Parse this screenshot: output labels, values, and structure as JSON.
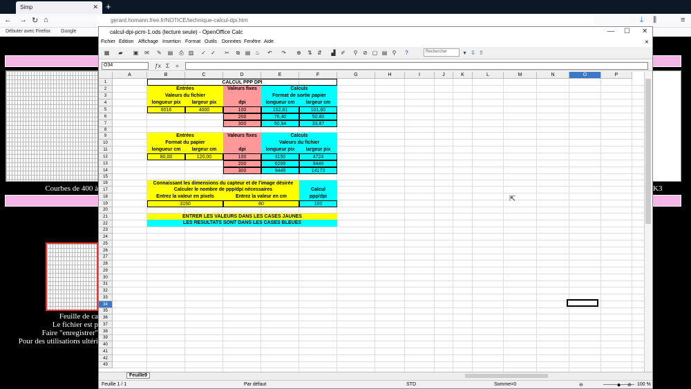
{
  "browser": {
    "tab_title": "Simp",
    "url": "gerard.homann.free.fr/NOTICE/technique-calcul-dpi.htm",
    "bookmarks": [
      "Débuter avec Firefox",
      "Google"
    ]
  },
  "page": {
    "caption1": "Courbes de 400 à",
    "caption_right": "K3",
    "lines": [
      "Feuille de ca",
      "Le fichier est p",
      "Faire \"enregistrer\"",
      "Pour des utilisations ultéri"
    ]
  },
  "calc": {
    "title": "calcul-dpi-pcm-1.ods (lecture seule) - OpenOffice Calc",
    "menu": [
      "Fichier",
      "Edition",
      "Affichage",
      "Insertion",
      "Format",
      "Outils",
      "Données",
      "Fenêtre",
      "Aide"
    ],
    "search_placeholder": "Rechercher",
    "namebox": "O34",
    "columns": [
      "A",
      "B",
      "C",
      "D",
      "E",
      "F",
      "G",
      "H",
      "I",
      "J",
      "K",
      "L",
      "M",
      "N",
      "O",
      "P"
    ],
    "rows": [
      "1",
      "2",
      "3",
      "4",
      "5",
      "6",
      "7",
      "8",
      "9",
      "10",
      "11",
      "12",
      "13",
      "14",
      "15",
      "16",
      "17",
      "18",
      "19",
      "20",
      "21",
      "22",
      "23",
      "24",
      "25",
      "26",
      "27",
      "28",
      "29",
      "30",
      "31",
      "32",
      "33",
      "34",
      "35",
      "36",
      "37",
      "38",
      "39",
      "40",
      "41",
      "42",
      "43"
    ],
    "sheet_tab": "Feuille9",
    "status": {
      "sheet": "Feuille 1 / 1",
      "style": "Par défaut",
      "mode": "STD",
      "sum": "Somme=0",
      "zoom": "100 %"
    },
    "cells": {
      "r1": "CALCUL PPP DPI",
      "r2b": "Entrées",
      "r2d": "Valeurs fixes",
      "r2e": "Calculs",
      "r3b": "Valeurs du fichier",
      "r3e": "Format de sortie papier",
      "r4b": "longueur pix",
      "r4c": "largeur pix",
      "r4d": "dpi",
      "r4e": "longueur cm",
      "r4f": "largeur cm",
      "r5b": "6016",
      "r5c": "4000",
      "r5d": "100",
      "r5e": "152,81",
      "r5f": "101,60",
      "r6d": "200",
      "r6e": "76,40",
      "r6f": "50,80",
      "r7d": "300",
      "r7e": "50,94",
      "r7f": "33,87",
      "r9b": "Entrées",
      "r9d": "Valeurs fixes",
      "r9e": "Calculs",
      "r10b": "Format du papier",
      "r10e": "Valeurs du fichier",
      "r11b": "longueur cm",
      "r11c": "largeur cm",
      "r11d": "dpi",
      "r11e": "longueur pix",
      "r11f": "largeur pix",
      "r12b": "80,00",
      "r12c": "120,00",
      "r12d": "100",
      "r12e": "3150",
      "r12f": "4724",
      "r13d": "200",
      "r13e": "6299",
      "r13f": "9449",
      "r14d": "300",
      "r14e": "9449",
      "r14f": "14173",
      "r16": "Connaissant les dimensions du capteur et de l'image désirée",
      "r17": "Calculer le nombre de ppp/dpi nécessaires",
      "r17f": "Calcul",
      "r18b": "Entrez la valeur en pixels",
      "r18d": "Entrez la valeur en cm",
      "r18f": "ppp/dpi",
      "r19b": "3150",
      "r19d": "80",
      "r19f": "100",
      "r21": "ENTRER LES VALEURS DANS LES CASES JAUNES",
      "r22": "LES RESULTATS SONT DANS LES CASES BLEUES"
    }
  }
}
